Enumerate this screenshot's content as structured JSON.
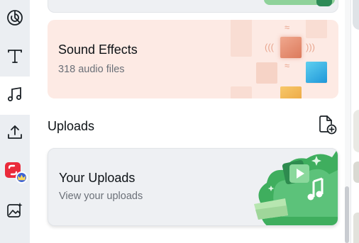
{
  "sidebar": {
    "items": [
      {
        "icon": "chart-icon",
        "name": "sidebar-item-charts"
      },
      {
        "icon": "text-icon",
        "name": "sidebar-item-text"
      },
      {
        "icon": "music-note-icon",
        "name": "sidebar-item-audio",
        "active": true
      },
      {
        "icon": "upload-icon",
        "name": "sidebar-item-uploads"
      },
      {
        "icon": "app-logo-icon",
        "name": "sidebar-item-app",
        "badge_icon": "crown-icon"
      },
      {
        "icon": "magic-image-icon",
        "name": "sidebar-item-magic-media"
      }
    ]
  },
  "sound_effects": {
    "title": "Sound Effects",
    "subtitle": "318 audio files"
  },
  "uploads_section": {
    "label": "Uploads",
    "action_icon": "add-file-icon"
  },
  "your_uploads": {
    "title": "Your Uploads",
    "subtitle": "View your uploads"
  },
  "colors": {
    "rail_bg": "#ebeef2",
    "sound_card_bg": "#fdeae4",
    "uploads_card_bg": "#eef0f3",
    "uploads_illustration_green": "#4cbb6c",
    "badge_crown": "#3d63d6"
  }
}
